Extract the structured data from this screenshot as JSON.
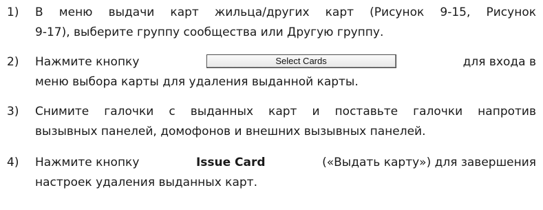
{
  "steps": [
    {
      "num": "1)",
      "lines": [
        "В меню выдачи карт жильца/других карт (Рисунок 9-15, Рисунок",
        "9-17), выберите группу сообщества или Другую группу."
      ]
    },
    {
      "num": "2)",
      "before": "Нажмите кнопку",
      "button_label": "Select Cards",
      "after": "для входа в",
      "line2": "меню выбора карты для удаления выданной карты."
    },
    {
      "num": "3)",
      "lines": [
        "Снимите галочки с выданных карт и поставьте галочки напротив",
        "вызывных панелей, домофонов и внешних вызывных панелей."
      ]
    },
    {
      "num": "4)",
      "pre": "Нажмите кнопку ",
      "bold": "Issue Card",
      "post": " («Выдать карту») для завершения",
      "line2": "настроек удаления выданных карт."
    }
  ]
}
